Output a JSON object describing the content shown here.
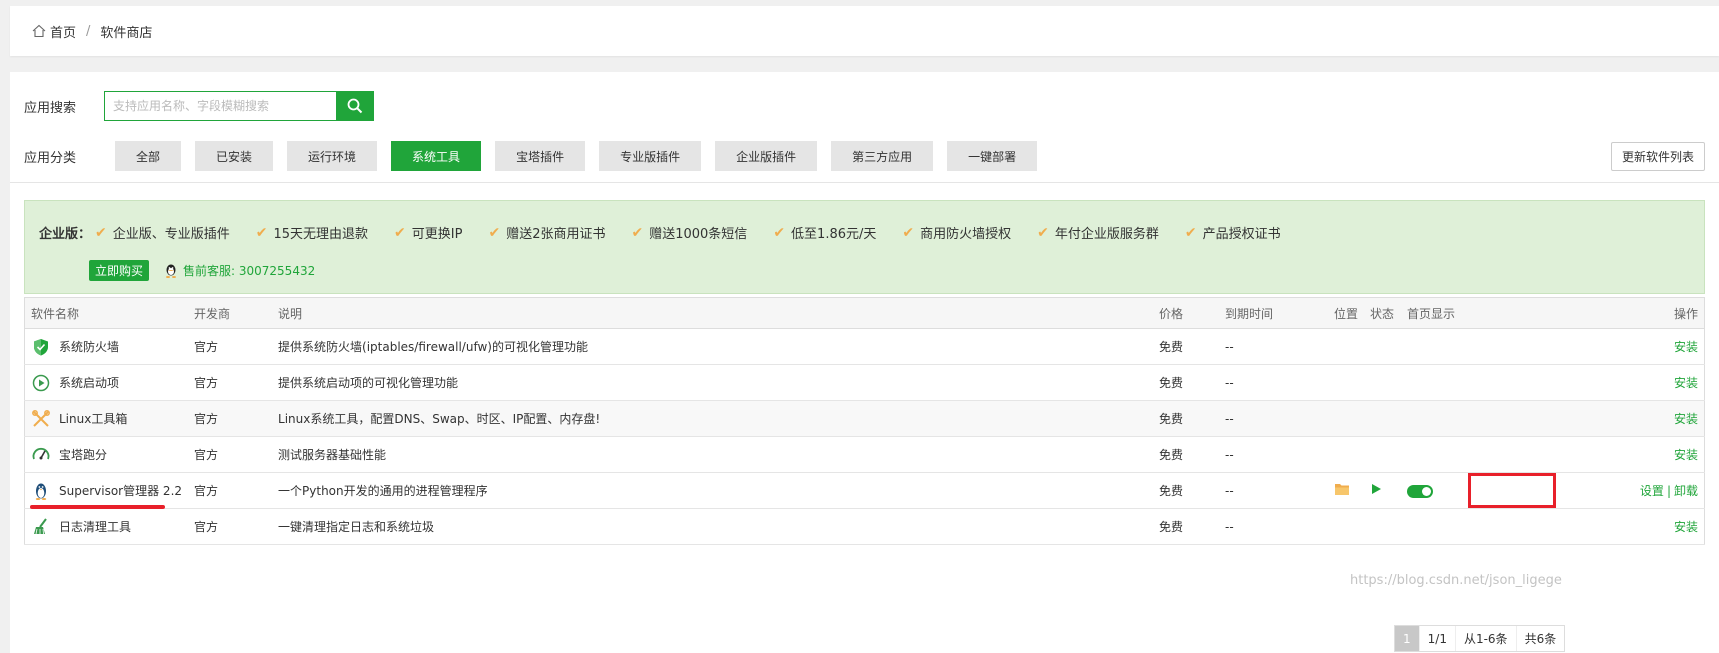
{
  "breadcrumb": {
    "home": "首页",
    "sep": "/",
    "current": "软件商店"
  },
  "search": {
    "label": "应用搜索",
    "placeholder": "支持应用名称、字段模糊搜索"
  },
  "categories": {
    "label": "应用分类",
    "items": [
      "全部",
      "已安装",
      "运行环境",
      "系统工具",
      "宝塔插件",
      "专业版插件",
      "企业版插件",
      "第三方应用",
      "一键部署"
    ],
    "active": "系统工具",
    "refresh": "更新软件列表"
  },
  "promo": {
    "title": "企业版：",
    "features": [
      "企业版、专业版插件",
      "15天无理由退款",
      "可更换IP",
      "赠送2张商用证书",
      "赠送1000条短信",
      "低至1.86元/天",
      "商用防火墙授权",
      "年付企业版服务群",
      "产品授权证书"
    ],
    "buy": "立即购买",
    "contact": "售前客服: 3007255432"
  },
  "table": {
    "headers": {
      "name": "软件名称",
      "dev": "开发商",
      "desc": "说明",
      "price": "价格",
      "expire": "到期时间",
      "pos": "位置",
      "status": "状态",
      "home": "首页显示",
      "op": "操作"
    },
    "rows": [
      {
        "name": "系统防火墙",
        "dev": "官方",
        "desc": "提供系统防火墙(iptables/firewall/ufw)的可视化管理功能",
        "price": "免费",
        "expire": "--",
        "op": "安装",
        "icon": "shield-icon"
      },
      {
        "name": "系统启动项",
        "dev": "官方",
        "desc": "提供系统启动项的可视化管理功能",
        "price": "免费",
        "expire": "--",
        "op": "安装",
        "icon": "play-circle-icon"
      },
      {
        "name": "Linux工具箱",
        "dev": "官方",
        "desc": "Linux系统工具，配置DNS、Swap、时区、IP配置、内存盘!",
        "price": "免费",
        "expire": "--",
        "op": "安装",
        "icon": "tools-icon"
      },
      {
        "name": "宝塔跑分",
        "dev": "官方",
        "desc": "测试服务器基础性能",
        "price": "免费",
        "expire": "--",
        "op": "安装",
        "icon": "gauge-icon"
      },
      {
        "name": "Supervisor管理器 2.2",
        "dev": "官方",
        "desc": "一个Python开发的通用的进程管理程序",
        "price": "免费",
        "expire": "--",
        "op_settings": "设置",
        "op_sep": "|",
        "op_uninstall": "卸载",
        "icon": "penguin-icon"
      },
      {
        "name": "日志清理工具",
        "dev": "官方",
        "desc": "一键清理指定日志和系统垃圾",
        "price": "免费",
        "expire": "--",
        "op": "安装",
        "icon": "broom-icon"
      }
    ]
  },
  "pager": {
    "current": "1",
    "pages": "1/1",
    "range": "从1-6条",
    "total": "共6条"
  },
  "watermark": "https://blog.csdn.net/json_ligege",
  "colors": {
    "accent": "#20a53a",
    "promo_bg": "#dff0d8",
    "check": "#f0ad4e",
    "annotation": "#e8202a"
  }
}
